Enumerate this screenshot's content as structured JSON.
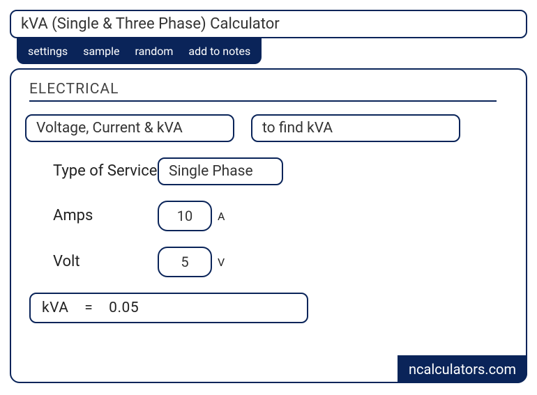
{
  "title": "kVA (Single & Three Phase) Calculator",
  "tabs": {
    "settings": "settings",
    "sample": "sample",
    "random": "random",
    "add_notes": "add to notes"
  },
  "section": "ELECTRICAL",
  "select1": "Voltage, Current & kVA",
  "select2": "to find kVA",
  "fields": {
    "service_label": "Type of Service",
    "service_value": "Single Phase",
    "amps_label": "Amps",
    "amps_value": "10",
    "amps_unit": "A",
    "volt_label": "Volt",
    "volt_value": "5",
    "volt_unit": "V"
  },
  "result": {
    "label": "kVA",
    "eq": "=",
    "value": "0.05"
  },
  "brand": "ncalculators.com"
}
